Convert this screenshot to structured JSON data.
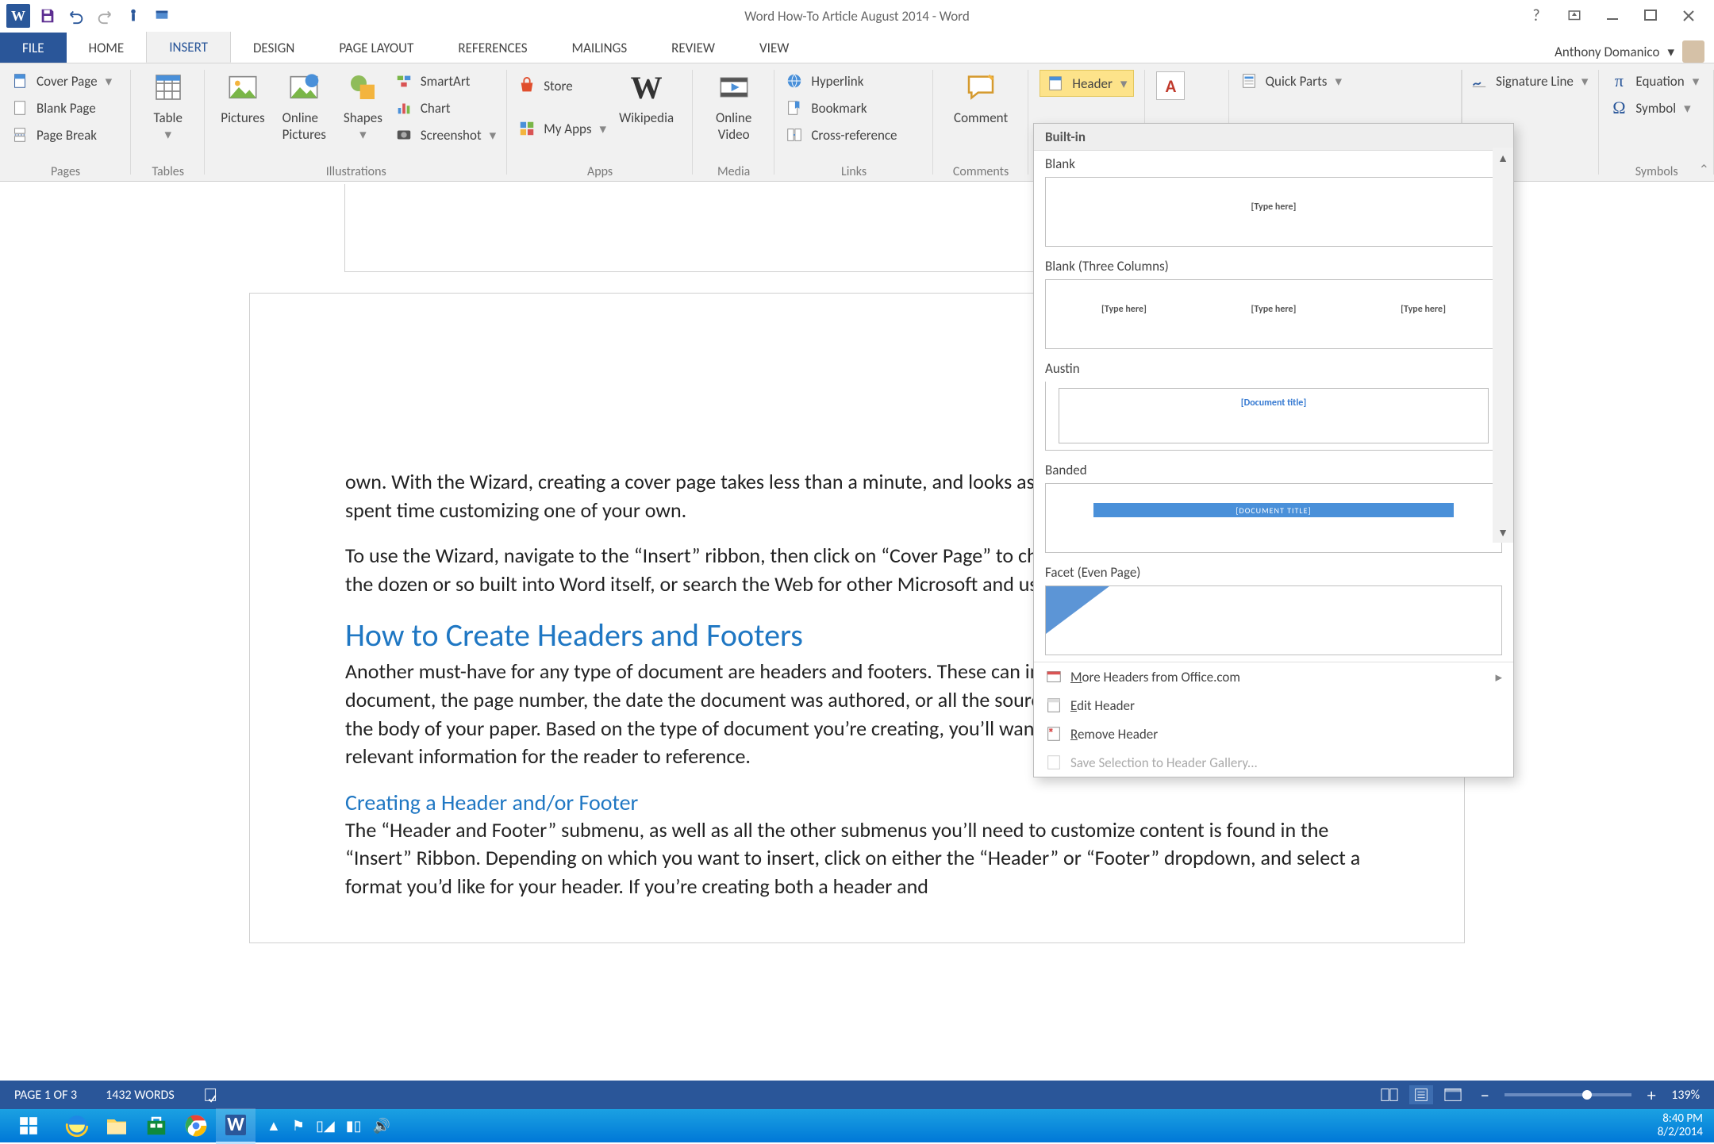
{
  "title": "Word How-To Article August 2014 - Word",
  "user": {
    "name": "Anthony Domanico"
  },
  "tabs": {
    "file": "FILE",
    "home": "HOME",
    "insert": "INSERT",
    "design": "DESIGN",
    "layout": "PAGE LAYOUT",
    "references": "REFERENCES",
    "mailings": "MAILINGS",
    "review": "REVIEW",
    "view": "VIEW"
  },
  "ribbon": {
    "pages": {
      "cover": "Cover Page",
      "blank": "Blank Page",
      "break": "Page Break",
      "group": "Pages"
    },
    "tables": {
      "table": "Table",
      "group": "Tables"
    },
    "illustrations": {
      "pictures": "Pictures",
      "online": "Online Pictures",
      "shapes": "Shapes",
      "smartart": "SmartArt",
      "chart": "Chart",
      "screenshot": "Screenshot",
      "group": "Illustrations"
    },
    "apps": {
      "store": "Store",
      "myapps": "My Apps",
      "wikipedia": "Wikipedia",
      "group": "Apps"
    },
    "media": {
      "video": "Online Video",
      "group": "Media"
    },
    "links": {
      "hyperlink": "Hyperlink",
      "bookmark": "Bookmark",
      "crossref": "Cross-reference",
      "group": "Links"
    },
    "comments": {
      "comment": "Comment",
      "group": "Comments"
    },
    "header_footer": {
      "header": "Header"
    },
    "text": {
      "quickparts": "Quick Parts",
      "signature": "Signature Line"
    },
    "symbols": {
      "equation": "Equation",
      "symbol": "Symbol",
      "group": "Symbols"
    }
  },
  "gallery": {
    "builtin": "Built-in",
    "blank": "Blank",
    "blank3": "Blank (Three Columns)",
    "austin": "Austin",
    "banded": "Banded",
    "facet": "Facet (Even Page)",
    "ph": "[Type here]",
    "austin_ph": "[Document title]",
    "banded_ph": "[DOCUMENT TITLE]",
    "more": "More Headers from Office.com",
    "edit": "Edit Header",
    "remove": "Remove Header",
    "save": "Save Selection to Header Gallery..."
  },
  "doc": {
    "p1": "own. With the Wizard, creating a cover page takes less than a minute, and looks as good (or even better) than if you’d spent time customizing one of your own.",
    "p2": "To use the Wizard, navigate to the “Insert” ribbon, then click on “Cover Page” to choose a design. You can select one of the dozen or so built into Word itself, or search the Web for other Microsoft and user-created templates.",
    "h2": "How to Create Headers and Footers",
    "p3": "Another must-have for any type of document are headers and footers. These can include things like the title of your document, the page number, the date the document was authored, or all the sources and citations you’ve referenced in the body of your paper. Based on the type of document you’re creating, you’ll want a header, footer, or both to put relevant information for the reader to reference.",
    "h3": "Creating a Header and/or Footer",
    "p4": "The “Header and Footer” submenu, as well as all the other submenus you’ll need to customize content is found in the “Insert” Ribbon. Depending on which you want to insert, click on either the “Header” or “Footer” dropdown, and select a format you’d like for your header. If you’re creating both a header and"
  },
  "status": {
    "page": "PAGE 1 OF 3",
    "words": "1432 WORDS",
    "zoom": "139%"
  },
  "clock": {
    "time": "8:40 PM",
    "date": "8/2/2014"
  }
}
